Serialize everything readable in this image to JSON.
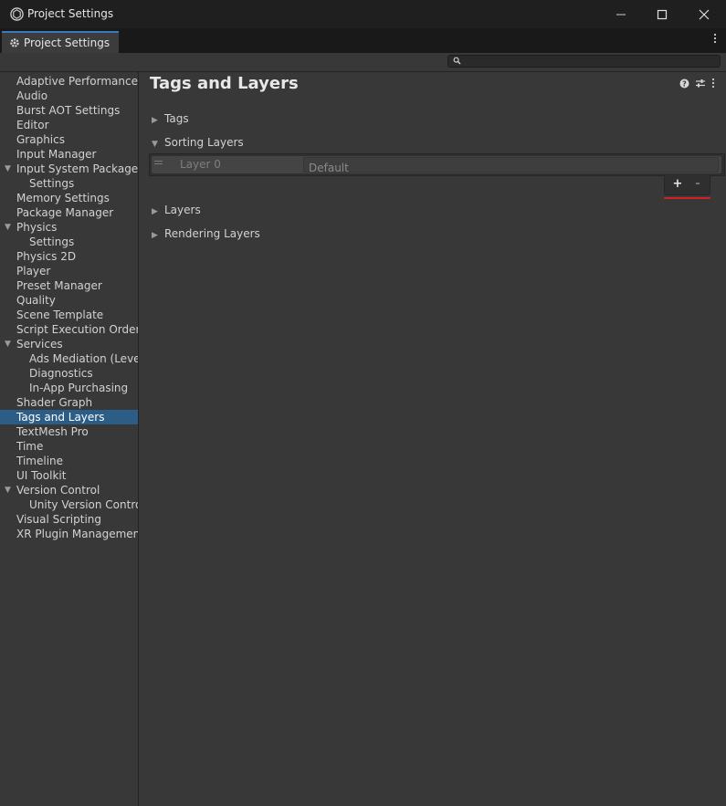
{
  "window": {
    "title": "Project Settings",
    "app_icon": "unity-logo-icon",
    "controls": [
      "minimize-icon",
      "maximize-icon",
      "close-icon"
    ]
  },
  "tab": {
    "label": "Project Settings",
    "icon": "gear-icon",
    "menu_icon": "kebab-menu-icon"
  },
  "search": {
    "value": "",
    "icon": "search-icon"
  },
  "sidebar": {
    "items": [
      {
        "label": "Adaptive Performance",
        "level": 0
      },
      {
        "label": "Audio",
        "level": 0
      },
      {
        "label": "Burst AOT Settings",
        "level": 0
      },
      {
        "label": "Editor",
        "level": 0
      },
      {
        "label": "Graphics",
        "level": 0
      },
      {
        "label": "Input Manager",
        "level": 0
      },
      {
        "label": "Input System Package",
        "level": 0,
        "expanded": true
      },
      {
        "label": "Settings",
        "level": 1
      },
      {
        "label": "Memory Settings",
        "level": 0
      },
      {
        "label": "Package Manager",
        "level": 0
      },
      {
        "label": "Physics",
        "level": 0,
        "expanded": true
      },
      {
        "label": "Settings",
        "level": 1
      },
      {
        "label": "Physics 2D",
        "level": 0
      },
      {
        "label": "Player",
        "level": 0
      },
      {
        "label": "Preset Manager",
        "level": 0
      },
      {
        "label": "Quality",
        "level": 0
      },
      {
        "label": "Scene Template",
        "level": 0
      },
      {
        "label": "Script Execution Order",
        "level": 0
      },
      {
        "label": "Services",
        "level": 0,
        "expanded": true
      },
      {
        "label": "Ads Mediation (Level",
        "level": 1
      },
      {
        "label": "Diagnostics",
        "level": 1
      },
      {
        "label": "In-App Purchasing",
        "level": 1
      },
      {
        "label": "Shader Graph",
        "level": 0
      },
      {
        "label": "Tags and Layers",
        "level": 0,
        "selected": true
      },
      {
        "label": "TextMesh Pro",
        "level": 0
      },
      {
        "label": "Time",
        "level": 0
      },
      {
        "label": "Timeline",
        "level": 0
      },
      {
        "label": "UI Toolkit",
        "level": 0
      },
      {
        "label": "Version Control",
        "level": 0,
        "expanded": true
      },
      {
        "label": "Unity Version Control",
        "level": 1
      },
      {
        "label": "Visual Scripting",
        "level": 0
      },
      {
        "label": "XR Plugin Management",
        "level": 0
      }
    ]
  },
  "main": {
    "title": "Tags and Layers",
    "header_icons": [
      "help-icon",
      "preset-sliders-icon",
      "kebab-menu-icon"
    ],
    "sections": {
      "tags": {
        "label": "Tags",
        "expanded": false
      },
      "sorting_layers": {
        "label": "Sorting Layers",
        "expanded": true
      },
      "layers": {
        "label": "Layers",
        "expanded": false
      },
      "rendering_layers": {
        "label": "Rendering Layers",
        "expanded": false
      }
    },
    "sorting_layer_rows": [
      {
        "label": "Layer 0",
        "value": "Default"
      }
    ],
    "list_buttons": {
      "add": "+",
      "remove": "-"
    },
    "highlight_color": "#d32020"
  },
  "colors": {
    "accent": "#3a79bb",
    "selection": "#2c5d87",
    "background": "#383838"
  }
}
